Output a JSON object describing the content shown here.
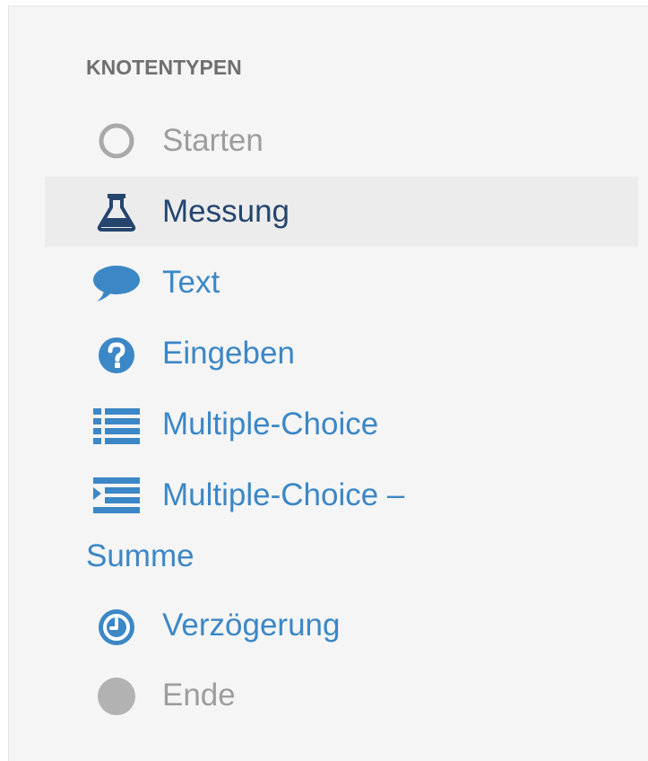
{
  "sidebar": {
    "heading": "KNOTENTYPEN",
    "items": [
      {
        "label": "Starten",
        "icon": "circle-outline-icon",
        "state": "disabled"
      },
      {
        "label": "Messung",
        "icon": "flask-icon",
        "state": "selected"
      },
      {
        "label": "Text",
        "icon": "speech-bubble-icon",
        "state": "normal"
      },
      {
        "label": "Eingeben",
        "icon": "question-circle-icon",
        "state": "normal"
      },
      {
        "label": "Multiple-Choice",
        "icon": "list-icon",
        "state": "normal"
      },
      {
        "label_line1": "Multiple-Choice –",
        "label_line2": "Summe",
        "icon": "indent-list-icon",
        "state": "normal"
      },
      {
        "label": "Verzögerung",
        "icon": "clock-icon",
        "state": "normal"
      },
      {
        "label": "Ende",
        "icon": "circle-filled-icon",
        "state": "disabled"
      }
    ]
  },
  "colors": {
    "panel_background": "#f5f5f5",
    "selected_background": "#ececec",
    "link_blue": "#3c87c6",
    "selected_text": "#24456e",
    "disabled_grey": "#9d9d9d",
    "heading_grey": "#6f6f6f"
  }
}
